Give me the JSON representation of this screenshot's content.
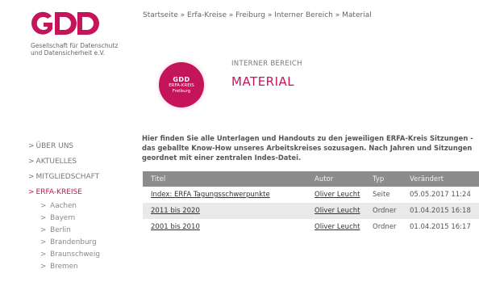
{
  "colors": {
    "brand": "#c4155a",
    "header_bg": "#8c8c8c",
    "row_alt": "#e9e9e9"
  },
  "logo": {
    "mark": "GDD",
    "subtitle_line1": "Gesellschaft für Datenschutz",
    "subtitle_line2": "und Datensicherheit e.V."
  },
  "breadcrumb": {
    "items": [
      "Startseite",
      "Erfa-Kreise",
      "Freiburg",
      "Interner Bereich",
      "Material"
    ],
    "separator": " » "
  },
  "badge": {
    "line1": "GDD",
    "line2": "ERFA-KREIS",
    "line3": "Freiburg"
  },
  "section": {
    "subtitle": "INTERNER BEREICH",
    "title": "MATERIAL"
  },
  "intro": {
    "line1": "Hier finden Sie alle Unterlagen und Handouts zu den jeweiligen ERFA-Kreis Sitzungen -",
    "line2": "das geballte Know-How unseres Arbeitskreises sozusagen. Nach Jahren und Sitzungen",
    "line3": "geordnet mit einer zentralen Indes-Datei."
  },
  "nav": {
    "arrow": ">",
    "items": [
      {
        "label": "ÜBER UNS"
      },
      {
        "label": "AKTUELLES"
      },
      {
        "label": "MITGLIEDSCHAFT"
      },
      {
        "label": "ERFA-KREISE"
      }
    ],
    "subitems": [
      {
        "label": "Aachen"
      },
      {
        "label": "Bayern"
      },
      {
        "label": "Berlin"
      },
      {
        "label": "Brandenburg"
      },
      {
        "label": "Braunschweig"
      },
      {
        "label": "Bremen"
      }
    ]
  },
  "table": {
    "headers": [
      "Titel",
      "Autor",
      "Typ",
      "Verändert"
    ],
    "rows": [
      {
        "title": "Index: ERFA Tagungsschwerpunkte",
        "author": "Oliver Leucht",
        "type": "Seite",
        "modified": "05.05.2017 11:24"
      },
      {
        "title": "2011 bis 2020",
        "author": "Oliver Leucht",
        "type": "Ordner",
        "modified": "01.04.2015 16:18"
      },
      {
        "title": "2001 bis 2010",
        "author": "Oliver Leucht",
        "type": "Ordner",
        "modified": "01.04.2015 16:17"
      }
    ]
  }
}
